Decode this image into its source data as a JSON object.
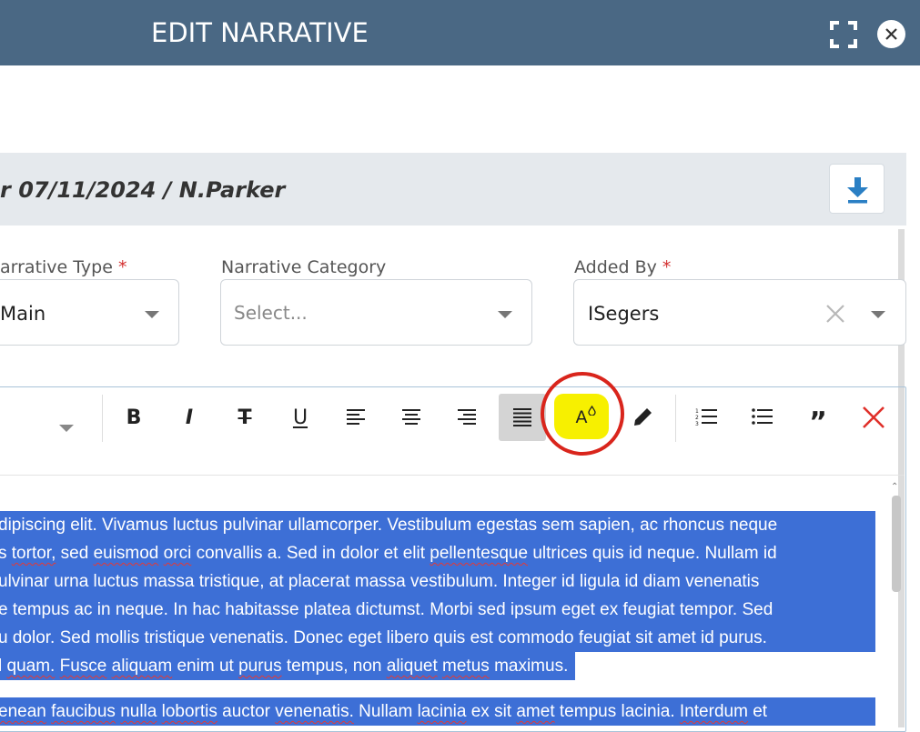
{
  "header": {
    "title": "EDIT NARRATIVE"
  },
  "meta": {
    "line": "r 07/11/2024 / N.Parker"
  },
  "fields": {
    "narrative_type": {
      "label": "arrative Type",
      "required_mark": "*",
      "value": "Main"
    },
    "narrative_category": {
      "label": "Narrative Category",
      "placeholder": "Select..."
    },
    "added_by": {
      "label": "Added By",
      "required_mark": "*",
      "value": "ISegers"
    }
  },
  "toolbar": {
    "buttons": [
      "bold",
      "italic",
      "strikethrough",
      "underline",
      "align-left",
      "align-center",
      "align-right",
      "align-justify",
      "text-highlight",
      "pen",
      "ordered-list",
      "bullet-list",
      "quote",
      "clear-formatting"
    ],
    "active": "align-justify",
    "labels": {
      "bold": "B",
      "italic": "I",
      "strike": "T",
      "underline": "U",
      "highlight": "A",
      "quote": "”"
    }
  },
  "annotation_color": "#d9251c",
  "highlight_color": "#f7f000",
  "selection_color": "#3d6fd6",
  "content": {
    "p1": [
      "dipiscing elit. Vivamus luctus pulvinar ullamcorper. Vestibulum egestas sem sapien, ac rhoncus neque",
      "s tortor, sed euismod orci convallis a. Sed in dolor et elit pellentesque ultrices quis id neque. Nullam id",
      "ulvinar urna luctus massa tristique, at placerat massa vestibulum. Integer id ligula id diam venenatis",
      "e tempus ac in neque. In hac habitasse platea dictumst. Morbi sed ipsum eget ex feugiat tempor. Sed",
      "u dolor. Sed mollis tristique venenatis. Donec eget libero quis est commodo feugiat sit amet id purus.",
      "l quam. Fusce aliquam enim ut purus tempus, non aliquet metus maximus."
    ],
    "p2": [
      "enean faucibus nulla lobortis auctor venenatis. Nullam lacinia ex sit amet tempus lacinia. Interdum et"
    ]
  }
}
